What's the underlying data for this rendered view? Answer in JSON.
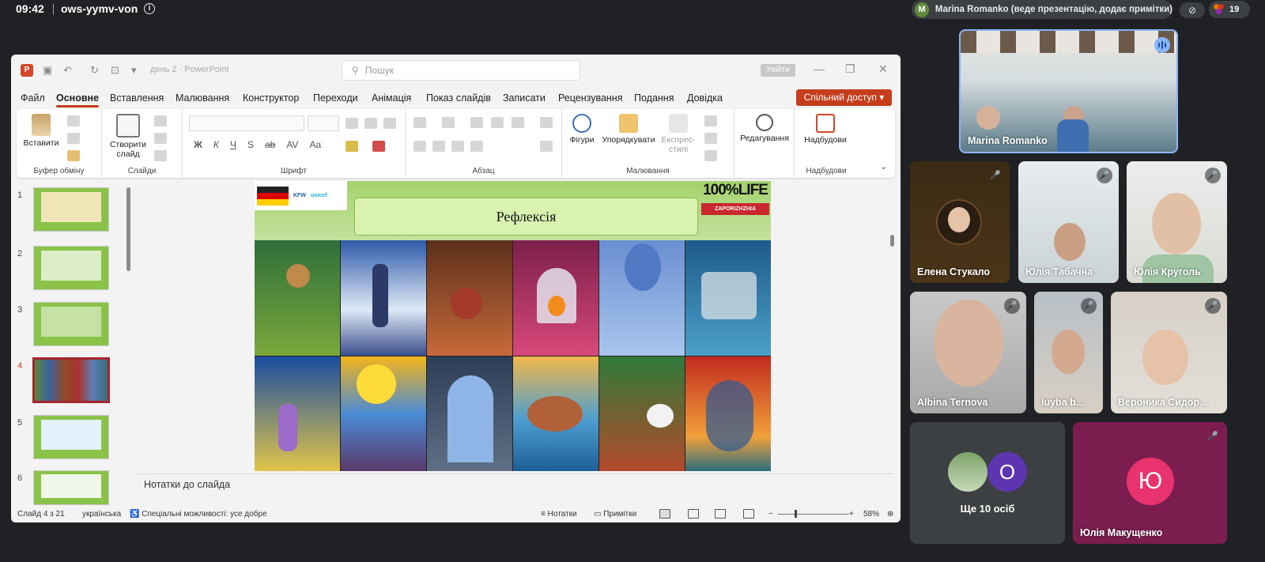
{
  "meet": {
    "time": "09:42",
    "code": "ows-yymv-von",
    "presenter_initial": "M",
    "presenter_text": "Marina Romanko (веде презентацію, додає примітки)",
    "participant_count": "19"
  },
  "ppt": {
    "app_icon": "P",
    "doc_title": "день 2  ·  PowerPoint",
    "search_placeholder": "Пошук",
    "signin_label": "Увійти",
    "tabs": [
      "Файл",
      "Основне",
      "Вставлення",
      "Малювання",
      "Конструктор",
      "Переходи",
      "Анімація",
      "Показ слайдів",
      "Записати",
      "Рецензування",
      "Подання",
      "Довідка"
    ],
    "active_tab": "Основне",
    "share_label": "Спільний доступ",
    "ribbon": {
      "paste": "Вставити",
      "new_slide_1": "Створити",
      "new_slide_2": "слайд",
      "group_clipboard": "Буфер обміну",
      "group_slides": "Слайди",
      "group_font": "Шрифт",
      "group_paragraph": "Абзац",
      "group_drawing": "Малювання",
      "group_addins": "Надбудови",
      "shapes": "Фігури",
      "arrange": "Упорядкувати",
      "quick_styles_1": "Експрес-",
      "quick_styles_2": "стилі",
      "editing": "Редагування",
      "addins": "Надбудови",
      "font_buttons": [
        "Ж",
        "К",
        "Ч",
        "S",
        "ab",
        "AV",
        "Aa"
      ]
    },
    "thumbnails": [
      {
        "num": "1"
      },
      {
        "num": "2"
      },
      {
        "num": "3"
      },
      {
        "num": "4"
      },
      {
        "num": "5"
      },
      {
        "num": "6"
      }
    ],
    "active_slide": "4",
    "slide": {
      "title": "Рефлексія",
      "logo_1": "KFW",
      "logo_2": "unicef",
      "brand_1": "100%LIFE",
      "brand_2": "ZAPORIZHZHIA"
    },
    "notes_placeholder": "Нотатки до слайда",
    "status": {
      "slide_of": "Слайд 4 з 21",
      "language": "українська",
      "accessibility": "Спеціальні можливості: усе добре",
      "notes_btn": "Нотатки",
      "comments_btn": "Примітки",
      "zoom": "58%"
    }
  },
  "participants": {
    "presenter_tile_name": "Marina Romanko",
    "tiles": [
      {
        "name": "Елена Стукало"
      },
      {
        "name": "Юлія Табачна"
      },
      {
        "name": "Юлія Круголь"
      },
      {
        "name": "Albina Ternova"
      },
      {
        "name": "luyba b..."
      },
      {
        "name": "Вероника Сидор..."
      }
    ],
    "others_label": "Ще 10 осіб",
    "others_initial": "О",
    "last_tile": {
      "name": "Юлія Макущенко",
      "initial": "Ю"
    }
  }
}
